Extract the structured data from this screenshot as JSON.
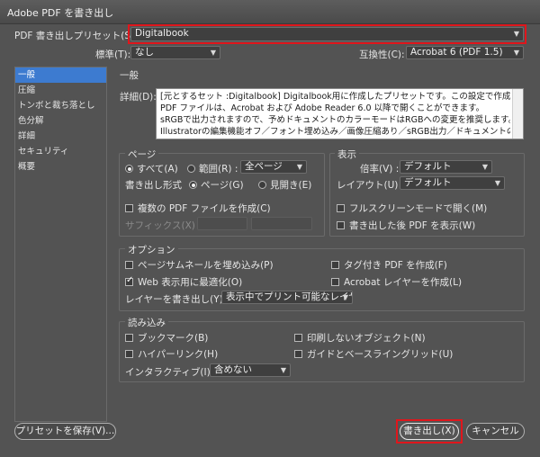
{
  "window": {
    "title": "Adobe PDF を書き出し"
  },
  "preset": {
    "label": "PDF 書き出しプリセット(S):",
    "value": "Digitalbook"
  },
  "standard": {
    "label": "標準(T):",
    "value": "なし"
  },
  "compat": {
    "label": "互換性(C):",
    "value": "Acrobat 6 (PDF 1.5)"
  },
  "sidebar": {
    "items": [
      {
        "label": "一般"
      },
      {
        "label": "圧縮"
      },
      {
        "label": "トンボと裁ち落とし"
      },
      {
        "label": "色分解"
      },
      {
        "label": "詳細"
      },
      {
        "label": "セキュリティ"
      },
      {
        "label": "概要"
      }
    ]
  },
  "general": {
    "heading": "一般",
    "desc_label": "詳細(D):",
    "desc_lines": [
      "[元とするセット :Digitalbook] Digitalbook用に作成したプリセットです。この設定で作成された",
      "PDF ファイルは、Acrobat および Adobe Reader 6.0 以降で開くことができます。",
      "sRGBで出力されますので、予めドキュメントのカラーモードはRGBへの変更を推奨します。",
      "Illustratorの編集機能オフ／フォント埋め込み／画像圧縮あり／sRGB出力／ドキュメントの裁ち"
    ]
  },
  "page": {
    "title": "ページ",
    "all": "すべて(A)",
    "range": "範囲(R) :",
    "range_value": "全ページ",
    "format_label": "書き出し形式",
    "pages": "ページ(G)",
    "spreads": "見開き(E)",
    "multi": "複数の PDF ファイルを作成(C)",
    "suffix": "サフィックス(X) :"
  },
  "view": {
    "title": "表示",
    "zoom_label": "倍率(V) :",
    "zoom_value": "デフォルト",
    "layout_label": "レイアウト(U) :",
    "layout_value": "デフォルト",
    "fullscreen": "フルスクリーンモードで開く(M)",
    "view_after": "書き出した後 PDF を表示(W)"
  },
  "options": {
    "title": "オプション",
    "thumbs": "ページサムネールを埋め込み(P)",
    "web": "Web 表示用に最適化(O)",
    "tagged": "タグ付き PDF を作成(F)",
    "acrobat_layers": "Acrobat レイヤーを作成(L)",
    "layers_label": "レイヤーを書き出し(Y) :",
    "layers_value": "表示中でプリント可能なレイヤー"
  },
  "include": {
    "title": "読み込み",
    "bookmarks": "ブックマーク(B)",
    "hyperlinks": "ハイパーリンク(H)",
    "nonprint": "印刷しないオブジェクト(N)",
    "guides": "ガイドとベースライングリッド(U)",
    "interactive_label": "インタラクティブ(I) :",
    "interactive_value": "含めない"
  },
  "buttons": {
    "save_preset": "プリセットを保存(V)...",
    "export": "書き出し(X)",
    "cancel": "キャンセル"
  },
  "colors": {
    "highlight": "#e0161c",
    "selection": "#3d7bd0",
    "background": "#535353"
  }
}
